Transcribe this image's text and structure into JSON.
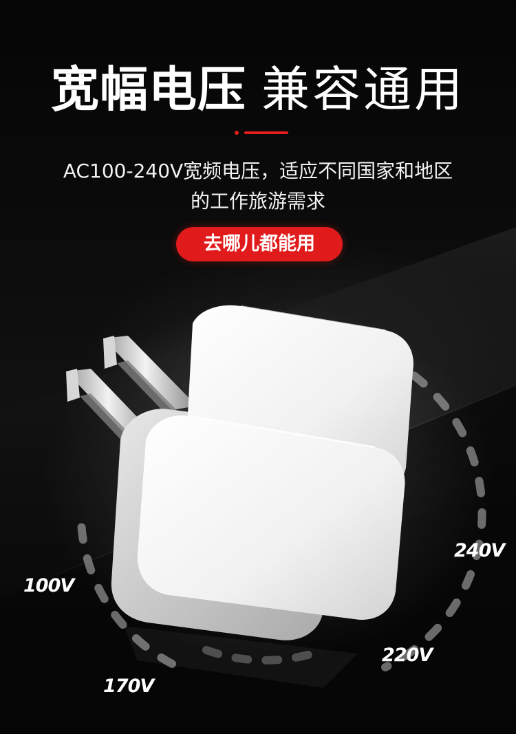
{
  "headline": {
    "bold_text": "宽幅电压",
    "light_text": "兼容通用"
  },
  "description": {
    "line1": "AC100-240V宽频电压，适应不同国家和地区",
    "line2": "的工作旅游需求"
  },
  "badge": {
    "label": "去哪儿都能用"
  },
  "voltage_labels": {
    "v100": "100V",
    "v170": "170V",
    "v220": "220V",
    "v240": "240V"
  },
  "colors": {
    "accent": "#e11b1b",
    "background": "#000000",
    "text": "#ffffff"
  },
  "icons": [
    "charger-image",
    "dashed-voltage-dial"
  ]
}
